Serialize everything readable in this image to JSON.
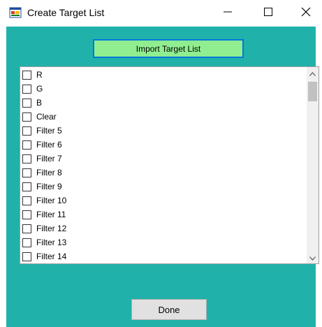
{
  "window": {
    "title": "Create Target List"
  },
  "toolbar": {
    "import_label": "Import Target List",
    "done_label": "Done"
  },
  "target_list": {
    "items": [
      {
        "label": "R",
        "checked": false
      },
      {
        "label": "G",
        "checked": false
      },
      {
        "label": "B",
        "checked": false
      },
      {
        "label": "Clear",
        "checked": false
      },
      {
        "label": "Filter 5",
        "checked": false
      },
      {
        "label": "Filter 6",
        "checked": false
      },
      {
        "label": "Filter 7",
        "checked": false
      },
      {
        "label": "Filter 8",
        "checked": false
      },
      {
        "label": "Filter 9",
        "checked": false
      },
      {
        "label": "Filter 10",
        "checked": false
      },
      {
        "label": "Filter 11",
        "checked": false
      },
      {
        "label": "Filter 12",
        "checked": false
      },
      {
        "label": "Filter 13",
        "checked": false
      },
      {
        "label": "Filter 14",
        "checked": false
      }
    ]
  },
  "colors": {
    "client_background": "#20b2aa",
    "import_button": "#90ee90",
    "focus_border": "#0078d7"
  },
  "icons": {
    "app": "app-window-icon",
    "minimize": "minimize-icon",
    "maximize": "maximize-icon",
    "close": "close-icon",
    "scroll_up": "chevron-up-icon",
    "scroll_down": "chevron-down-icon"
  }
}
